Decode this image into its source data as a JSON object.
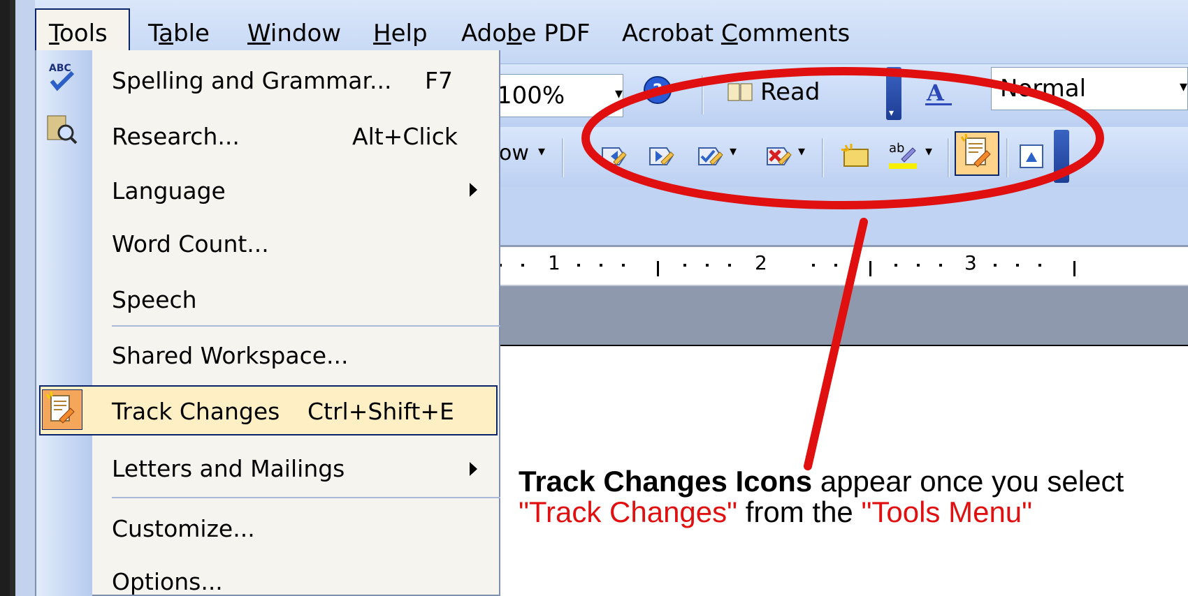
{
  "menubar": {
    "items": [
      {
        "label": "Tools",
        "u": "T",
        "rest": "ools"
      },
      {
        "label": "Table",
        "pre": "T",
        "u": "a",
        "rest": "ble"
      },
      {
        "label": "Window",
        "u": "W",
        "rest": "indow"
      },
      {
        "label": "Help",
        "u": "H",
        "rest": "elp"
      },
      {
        "label": "Adobe PDF",
        "pre": "Ado",
        "u": "b",
        "rest": "e PDF"
      },
      {
        "label": "Acrobat Comments",
        "pre": "Acrobat ",
        "u": "C",
        "rest": "omments"
      }
    ],
    "cut_char": ":"
  },
  "toolbar": {
    "zoom": "100%",
    "read_label": "Read",
    "style": "Normal",
    "show_label": "ow"
  },
  "tools_menu": {
    "items": [
      {
        "label": "Spelling and Grammar...",
        "shortcut": "F7",
        "icon": "spelling-abc-icon"
      },
      {
        "label": "Research...",
        "shortcut": "Alt+Click",
        "icon": "research-icon"
      },
      {
        "label": "Language",
        "submenu": true
      },
      {
        "label": "Word Count..."
      },
      {
        "label": "Speech"
      },
      {
        "label": "Shared Workspace..."
      },
      {
        "label": "Track Changes",
        "shortcut": "Ctrl+Shift+E",
        "icon": "track-changes-icon",
        "highlighted": true
      },
      {
        "label": "Letters and Mailings",
        "submenu": true
      },
      {
        "label": "Customize..."
      },
      {
        "label": "Options..."
      }
    ]
  },
  "ruler": {
    "numbers": [
      "1",
      "2",
      "3"
    ]
  },
  "callout": {
    "bold": "Track Changes Icons",
    "t1": " appear once you select ",
    "red1": "\"Track Changes\"",
    "t2": " from the ",
    "red2": "\"Tools Menu\""
  },
  "colors": {
    "annotation": "#e01010",
    "menu_highlight": "#ffefc5",
    "menu_border": "#0a246a"
  }
}
